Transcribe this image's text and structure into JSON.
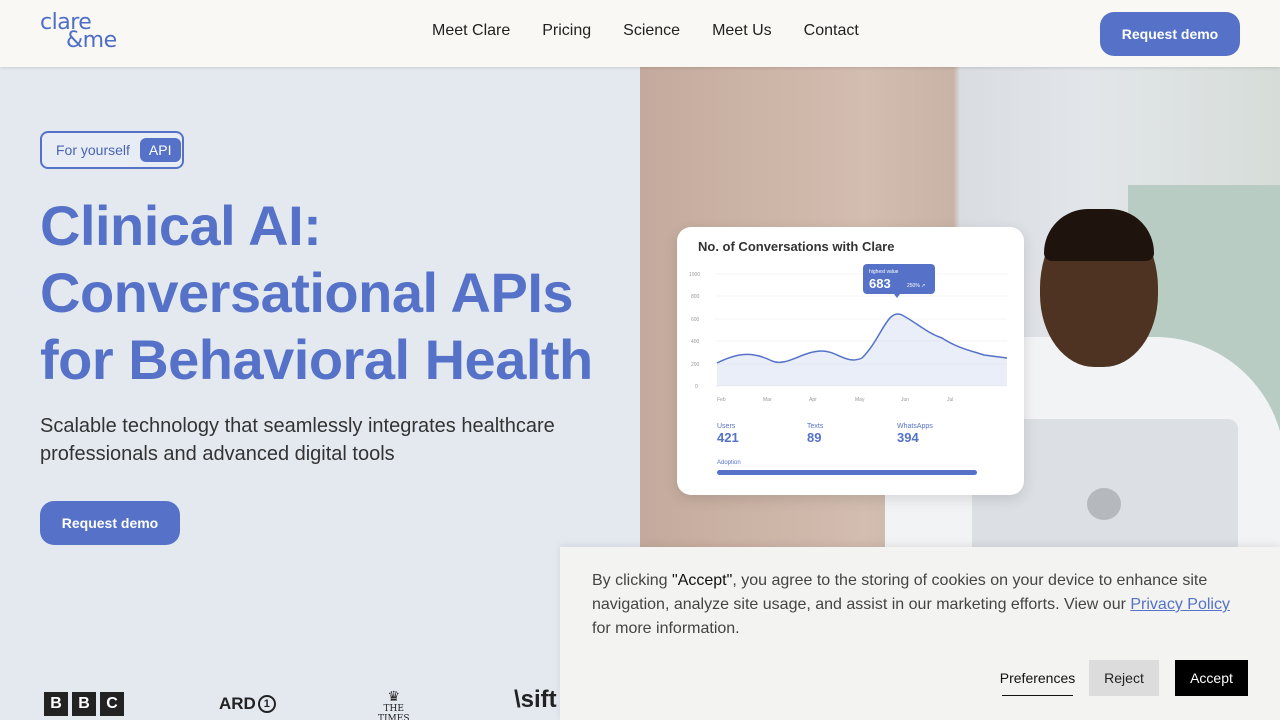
{
  "header": {
    "logo_line1": "clare",
    "logo_line2": "&me",
    "nav": [
      "Meet Clare",
      "Pricing",
      "Science",
      "Meet Us",
      "Contact"
    ],
    "cta_label": "Request demo"
  },
  "hero": {
    "toggle_option1": "For yourself",
    "toggle_option2": "API",
    "title_line1": "Clinical AI:",
    "title_line2": "Conversational APIs",
    "title_line3": "for Behavioral Health",
    "subtitle": "Scalable technology that seamlessly integrates healthcare professionals and advanced digital tools",
    "cta_label": "Request demo"
  },
  "dashboard": {
    "title": "No. of Conversations with Clare",
    "tooltip_label": "highest value",
    "tooltip_value": "683",
    "tooltip_badge": "250% ↗",
    "y_ticks": [
      "1000",
      "800",
      "600",
      "400",
      "200",
      "0"
    ],
    "x_ticks": [
      "Feb",
      "Mar",
      "Apr",
      "May",
      "Jun",
      "Jul"
    ],
    "stats": [
      {
        "label": "Users",
        "value": "421"
      },
      {
        "label": "Texts",
        "value": "89"
      },
      {
        "label": "WhatsApps",
        "value": "394"
      }
    ],
    "adoption_label": "Adoption"
  },
  "press": {
    "bbc": [
      "B",
      "B",
      "C"
    ],
    "ard_text": "ARD",
    "ard_badge": "1",
    "times_text": "THE TIMES",
    "sift_text": "\\sift"
  },
  "cookie": {
    "text_before": "By clicking ",
    "text_accept": "\"Accept\"",
    "text_middle": ", you agree to the storing of cookies on your device to enhance site navigation, analyze site usage, and assist in our marketing efforts. View our ",
    "privacy_link": "Privacy Policy",
    "text_after": " for more information.",
    "preferences_label": "Preferences",
    "reject_label": "Reject",
    "accept_label": "Accept"
  },
  "colors": {
    "brand": "#5572c8",
    "background": "#e4e9f0",
    "header_bg": "#f9f8f4"
  }
}
